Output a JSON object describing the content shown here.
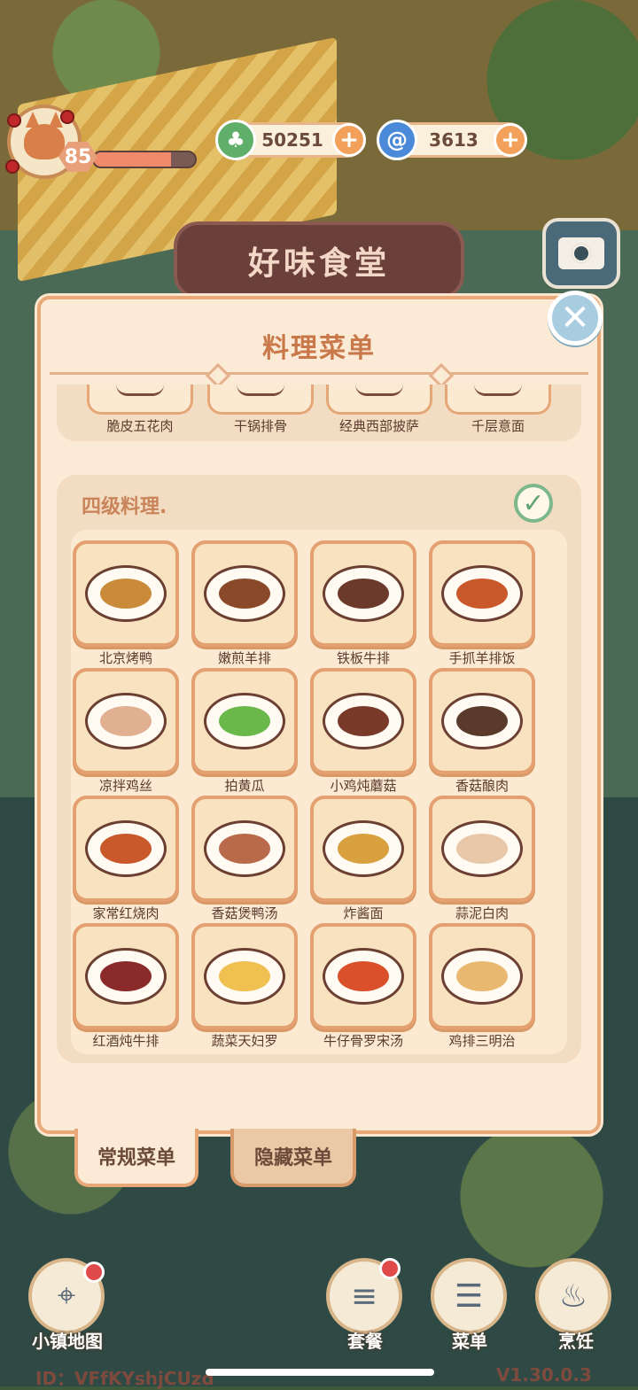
{
  "hud": {
    "level": "85",
    "exp_progress": 0.76,
    "currency1": {
      "value": "50251",
      "icon": "clover-coin-icon",
      "color": "#5fae6a"
    },
    "currency2": {
      "value": "3613",
      "icon": "swirl-gem-icon",
      "color": "#4a8ad9"
    }
  },
  "restaurant_sign": "好味食堂",
  "menu": {
    "title": "料理菜单",
    "prev_section_dishes": [
      "脆皮五花肉",
      "干锅排骨",
      "经典西部披萨",
      "千层意面"
    ],
    "section": {
      "title": "四级料理.",
      "completed": true,
      "dishes": [
        {
          "name": "北京烤鸭",
          "color": "#c98a3a"
        },
        {
          "name": "嫩煎羊排",
          "color": "#8a4a2a"
        },
        {
          "name": "铁板牛排",
          "color": "#6b3a2a"
        },
        {
          "name": "手抓羊排饭",
          "color": "#c9582a"
        },
        {
          "name": "凉拌鸡丝",
          "color": "#e0b090"
        },
        {
          "name": "拍黄瓜",
          "color": "#6ab84a"
        },
        {
          "name": "小鸡炖蘑菇",
          "color": "#7a3a2a"
        },
        {
          "name": "香菇酿肉",
          "color": "#5a3a2a"
        },
        {
          "name": "家常红烧肉",
          "color": "#c9582a"
        },
        {
          "name": "香菇煲鸭汤",
          "color": "#b86a4a"
        },
        {
          "name": "炸酱面",
          "color": "#d9a040"
        },
        {
          "name": "蒜泥白肉",
          "color": "#e8c8a8"
        },
        {
          "name": "红酒炖牛排",
          "color": "#8a2a2a"
        },
        {
          "name": "蔬菜天妇罗",
          "color": "#f0c050"
        },
        {
          "name": "牛仔骨罗宋汤",
          "color": "#d9502a"
        },
        {
          "name": "鸡排三明治",
          "color": "#e8b870"
        }
      ]
    }
  },
  "tabs": {
    "regular": "常规菜单",
    "hidden": "隐藏菜单"
  },
  "nav": {
    "map": "小镇地图",
    "set_meal": "套餐",
    "menu": "菜单",
    "cook": "烹饪"
  },
  "footer": {
    "user_id": "ID：VFfKYshjCUzd",
    "version": "V1.30.0.3"
  }
}
